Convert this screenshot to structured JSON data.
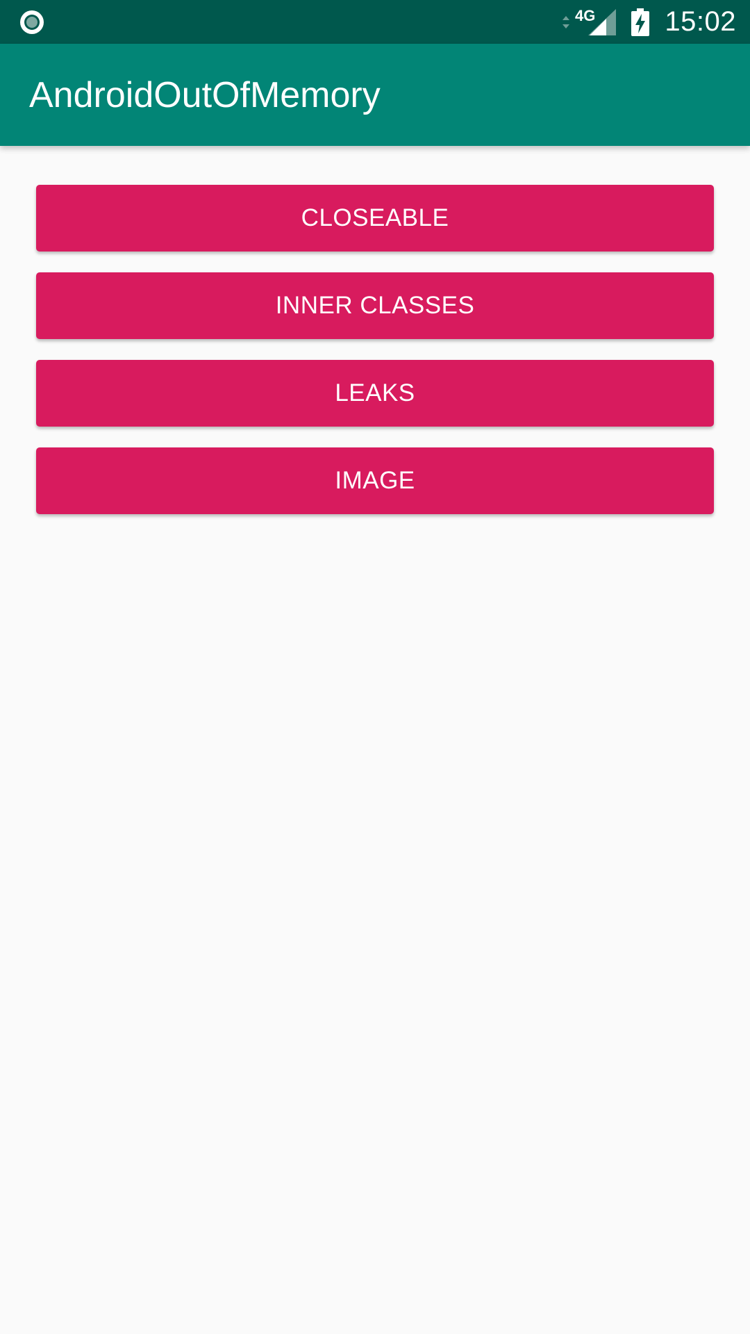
{
  "status_bar": {
    "network_type": "4G",
    "time": "15:02",
    "icons": {
      "left": "record-circle-icon",
      "network_activity": "network-arrows-icon",
      "signal": "cell-signal-icon",
      "battery": "battery-charging-icon"
    }
  },
  "app_bar": {
    "title": "AndroidOutOfMemory"
  },
  "buttons": [
    {
      "label": "CLOSEABLE"
    },
    {
      "label": "INNER CLASSES"
    },
    {
      "label": "LEAKS"
    },
    {
      "label": "IMAGE"
    }
  ],
  "colors": {
    "status_bar": "#00584D",
    "app_bar": "#028576",
    "button": "#D81B5E",
    "background": "#FAFAFA",
    "on_primary_text": "#FFFFFF"
  }
}
